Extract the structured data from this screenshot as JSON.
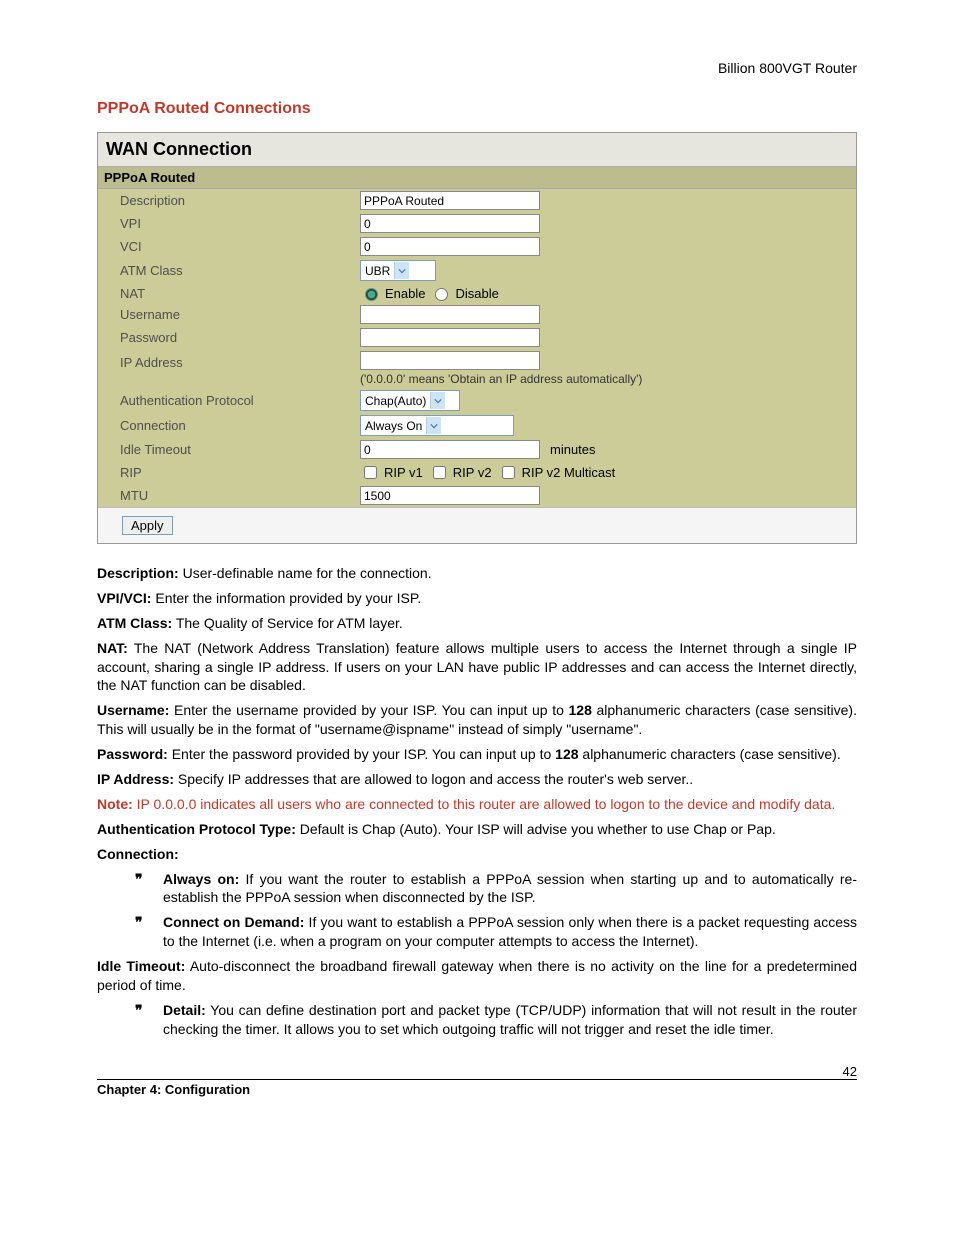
{
  "header": {
    "product": "Billion 800VGT Router"
  },
  "section_title": "PPPoA Routed Connections",
  "panel": {
    "title": "WAN Connection",
    "subtitle": "PPPoA Routed",
    "fields": {
      "description": {
        "label": "Description",
        "value": "PPPoA Routed"
      },
      "vpi": {
        "label": "VPI",
        "value": "0"
      },
      "vci": {
        "label": "VCI",
        "value": "0"
      },
      "atm_class": {
        "label": "ATM Class",
        "value": "UBR"
      },
      "nat": {
        "label": "NAT",
        "enable": "Enable",
        "disable": "Disable"
      },
      "username": {
        "label": "Username",
        "value": ""
      },
      "password": {
        "label": "Password",
        "value": ""
      },
      "ip_address": {
        "label": "IP Address",
        "value": "",
        "hint": "('0.0.0.0' means 'Obtain an IP address automatically')"
      },
      "auth": {
        "label": "Authentication Protocol",
        "value": "Chap(Auto)"
      },
      "connection": {
        "label": "Connection",
        "value": "Always On"
      },
      "idle": {
        "label": "Idle Timeout",
        "value": "0",
        "suffix": "minutes"
      },
      "rip": {
        "label": "RIP",
        "v1": "RIP v1",
        "v2": "RIP v2",
        "v2m": "RIP v2 Multicast"
      },
      "mtu": {
        "label": "MTU",
        "value": "1500"
      }
    },
    "apply": "Apply"
  },
  "doc": {
    "p1": {
      "b": "Description:",
      "t": " User-definable name for the connection."
    },
    "p2": {
      "b": "VPI/VCI:",
      "t": " Enter the information provided by your ISP."
    },
    "p3": {
      "b": "ATM Class:",
      "t": " The Quality of Service for ATM layer."
    },
    "p4": {
      "b": "NAT:",
      "t": " The NAT (Network Address Translation) feature allows multiple users to access the Internet through a single IP account, sharing a single IP address. If users on your LAN have public IP addresses and can access the Internet directly, the NAT function can be disabled."
    },
    "p5": {
      "b": "Username:",
      "t1": " Enter the username provided by your ISP. You can input up to ",
      "n": "128",
      "t2": " alphanumeric characters (case sensitive). This will usually be in the format of \"username@ispname\" instead of simply \"username\"."
    },
    "p6": {
      "b": "Password:",
      "t1": " Enter the password provided by your ISP. You can input up to ",
      "n": "128",
      "t2": " alphanumeric characters (case sensitive)."
    },
    "p7": {
      "b": "IP Address:",
      "t": " Specify IP addresses that are allowed to logon and access the router's web server.."
    },
    "note": {
      "b": "Note:",
      "t": " IP 0.0.0.0 indicates all users who are connected to this router are allowed to logon to the device and modify data."
    },
    "p8": {
      "b": "Authentication Protocol Type:",
      "t": " Default is Chap (Auto). Your ISP will advise you whether to use Chap or Pap."
    },
    "p9": {
      "b": "Connection:"
    },
    "b1": {
      "b": "Always on:",
      "t": " If you want the router to establish a PPPoA session when starting up and to automatically re-establish the PPPoA session when disconnected by the ISP."
    },
    "b2": {
      "b": "Connect on Demand:",
      "t": " If you want to establish a PPPoA session only when there is a packet requesting access to the Internet (i.e. when a program on your computer attempts to access the Internet)."
    },
    "p10": {
      "b": "Idle Timeout:",
      "t": " Auto-disconnect the broadband firewall gateway when there is no activity on the line for a predetermined period of time."
    },
    "b3": {
      "b": "Detail:",
      "t": " You can define destination port and packet type (TCP/UDP) information that will not result in the router checking the timer. It allows you to set which outgoing traffic will not trigger and reset the idle timer."
    }
  },
  "footer": {
    "chapter": "Chapter 4: Configuration",
    "page": "42"
  }
}
